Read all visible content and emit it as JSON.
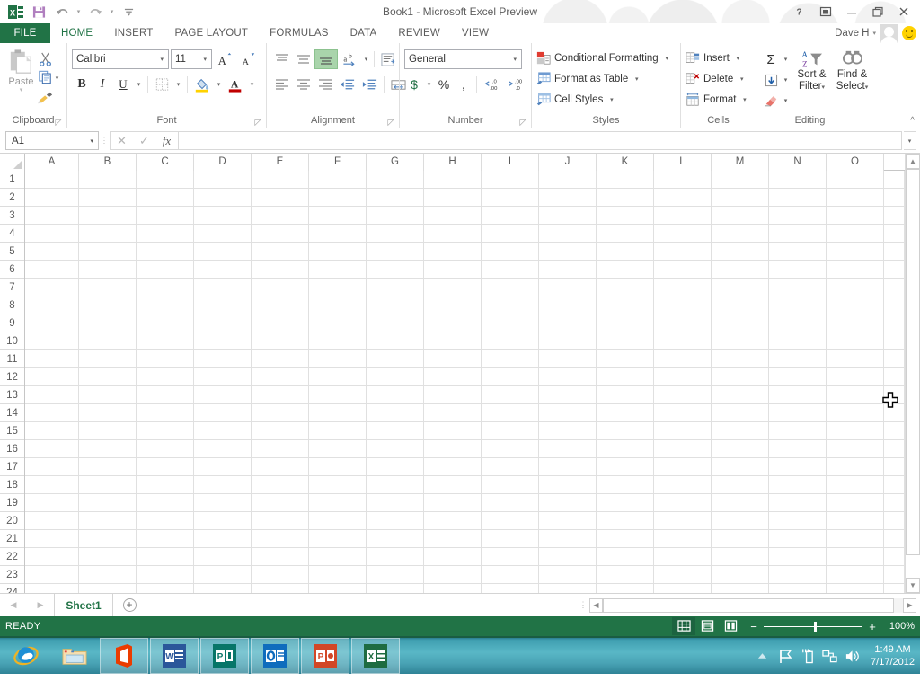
{
  "titlebar": {
    "title": "Book1 - Microsoft Excel Preview",
    "qat": [
      {
        "name": "excel-logo-icon",
        "label": "X"
      },
      {
        "name": "save-icon",
        "label": "Save"
      },
      {
        "name": "undo-icon",
        "label": "Undo"
      },
      {
        "name": "redo-icon",
        "label": "Redo"
      },
      {
        "name": "customize-qat-icon",
        "label": "Customize Quick Access Toolbar"
      }
    ],
    "help_label": "?",
    "ribbon_display_label": "Ribbon Display Options",
    "minimize_label": "Minimize",
    "restore_label": "Restore Down",
    "close_label": "Close"
  },
  "tabs": {
    "file": "FILE",
    "items": [
      "HOME",
      "INSERT",
      "PAGE LAYOUT",
      "FORMULAS",
      "DATA",
      "REVIEW",
      "VIEW"
    ],
    "active": "HOME"
  },
  "user": {
    "name": "Dave H",
    "caret": "▾",
    "smiley_label": "Send a Smile"
  },
  "ribbon": {
    "collapse_label": "^",
    "groups": [
      {
        "name": "clipboard",
        "label": "Clipboard",
        "paste": {
          "label": "Paste",
          "caret": "▾"
        },
        "cut": "Cut",
        "copy": "Copy",
        "copy_caret": "▾",
        "format_painter": "Format Painter",
        "launcher": "◸"
      },
      {
        "name": "font",
        "label": "Font",
        "font_name": "Calibri",
        "font_size": "11",
        "grow_font": "A",
        "shrink_font": "A",
        "bold": "B",
        "italic": "I",
        "underline": "U",
        "underline_caret": "▾",
        "borders": "Borders",
        "borders_caret": "▾",
        "fill_color": "Fill Color",
        "fill_caret": "▾",
        "font_color": "A",
        "font_caret": "▾",
        "launcher": "◸"
      },
      {
        "name": "alignment",
        "label": "Alignment",
        "align_top": "Top Align",
        "align_middle": "Middle Align",
        "align_bottom": "Bottom Align",
        "orientation": "Orientation",
        "orientation_caret": "▾",
        "wrap_text": "Wrap Text",
        "align_left": "Align Left",
        "align_center": "Center",
        "align_right": "Align Right",
        "decrease_indent": "Decrease Indent",
        "increase_indent": "Increase Indent",
        "merge_center": "Merge & Center",
        "merge_caret": "▾",
        "launcher": "◸"
      },
      {
        "name": "number",
        "label": "Number",
        "format": "General",
        "format_caret": "▾",
        "accounting": "$",
        "accounting_caret": "▾",
        "percent": "%",
        "comma": ",",
        "increase_decimal": "Increase Decimal",
        "decrease_decimal": "Decrease Decimal",
        "launcher": "◸"
      },
      {
        "name": "styles",
        "label": "Styles",
        "items": [
          {
            "label": "Conditional Formatting",
            "caret": "▾"
          },
          {
            "label": "Format as Table",
            "caret": "▾"
          },
          {
            "label": "Cell Styles",
            "caret": "▾"
          }
        ]
      },
      {
        "name": "cells",
        "label": "Cells",
        "items": [
          {
            "label": "Insert",
            "caret": "▾"
          },
          {
            "label": "Delete",
            "caret": "▾"
          },
          {
            "label": "Format",
            "caret": "▾"
          }
        ]
      },
      {
        "name": "editing",
        "label": "Editing",
        "autosum": "Σ",
        "autosum_caret": "▾",
        "fill": "Fill",
        "fill_caret": "▾",
        "clear": "Clear",
        "clear_caret": "▾",
        "sort_filter_line1": "Sort &",
        "sort_filter_line2": "Filter",
        "sort_filter_caret": "▾",
        "find_select_line1": "Find &",
        "find_select_line2": "Select",
        "find_select_caret": "▾"
      }
    ]
  },
  "formulabar": {
    "namebox_value": "A1",
    "namebox_caret": "▾",
    "cancel": "✕",
    "enter": "✓",
    "insert_function": "fx",
    "value": "",
    "expand_caret": "▾"
  },
  "grid": {
    "columns": [
      "A",
      "B",
      "C",
      "D",
      "E",
      "F",
      "G",
      "H",
      "I",
      "J",
      "K",
      "L",
      "M",
      "N",
      "O"
    ],
    "rows": [
      "1",
      "2",
      "3",
      "4",
      "5",
      "6",
      "7",
      "8",
      "9",
      "10",
      "11",
      "12",
      "13",
      "14",
      "15",
      "16",
      "17",
      "18",
      "19",
      "20",
      "21",
      "22",
      "23",
      "24"
    ],
    "selected_cell": "A1",
    "cursor": "white-cross"
  },
  "sheetbar": {
    "prev_label": "◀",
    "next_label": "▶",
    "tabs": [
      "Sheet1"
    ],
    "active_tab": "Sheet1",
    "new_sheet_label": "+",
    "hscroll_left": "◀",
    "hscroll_right": "▶"
  },
  "statusbar": {
    "status": "READY",
    "views": [
      {
        "name": "normal-view",
        "label": "Normal",
        "active": true
      },
      {
        "name": "page-layout-view",
        "label": "Page Layout",
        "active": false
      },
      {
        "name": "page-break-preview",
        "label": "Page Break Preview",
        "active": false
      }
    ],
    "zoom_out": "−",
    "zoom_in": "+",
    "zoom_level": "100%",
    "accent_color": "#217346"
  },
  "taskbar": {
    "items": [
      {
        "name": "internet-explorer-icon",
        "label": "Internet Explorer",
        "boxed": false
      },
      {
        "name": "file-explorer-icon",
        "label": "File Explorer",
        "boxed": false
      },
      {
        "name": "office-icon",
        "label": "Office",
        "boxed": true,
        "color": "#eb3c00"
      },
      {
        "name": "word-icon",
        "label": "Word",
        "boxed": true,
        "color": "#2b579a",
        "glyph": "W"
      },
      {
        "name": "publisher-icon",
        "label": "Publisher",
        "boxed": true,
        "color": "#077568",
        "glyph": "P"
      },
      {
        "name": "outlook-icon",
        "label": "Outlook",
        "boxed": true,
        "color": "#0f6cbd",
        "glyph": "O"
      },
      {
        "name": "powerpoint-icon",
        "label": "PowerPoint",
        "boxed": true,
        "color": "#d24726",
        "glyph": "P"
      },
      {
        "name": "excel-icon",
        "label": "Excel",
        "boxed": true,
        "color": "#1e6c41",
        "glyph": "X"
      }
    ],
    "tray": [
      {
        "name": "show-hidden-icons-icon",
        "label": "▲"
      },
      {
        "name": "action-center-flag-icon",
        "label": "Flag"
      },
      {
        "name": "battery-icon",
        "label": "Battery"
      },
      {
        "name": "network-icon",
        "label": "Network"
      },
      {
        "name": "volume-icon",
        "label": "Volume"
      }
    ],
    "clock_time": "1:49 AM",
    "clock_date": "7/17/2012"
  }
}
